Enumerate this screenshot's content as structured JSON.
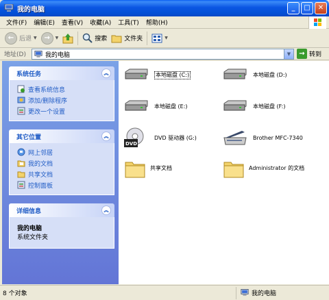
{
  "window": {
    "title": "我的电脑"
  },
  "menubar": {
    "items": [
      "文件(F)",
      "编辑(E)",
      "查看(V)",
      "收藏(A)",
      "工具(T)",
      "帮助(H)"
    ]
  },
  "toolbar": {
    "back": "后退",
    "search": "搜索",
    "folders": "文件夹"
  },
  "address": {
    "label": "地址(D)",
    "value": "我的电脑",
    "go": "转到"
  },
  "panels": {
    "system_tasks": {
      "title": "系统任务",
      "items": [
        "查看系统信息",
        "添加/删除程序",
        "更改一个设置"
      ]
    },
    "other_places": {
      "title": "其它位置",
      "items": [
        "网上邻居",
        "我的文档",
        "共享文档",
        "控制面板"
      ]
    },
    "details": {
      "title": "详细信息",
      "name": "我的电脑",
      "sub": "系统文件夹"
    }
  },
  "items": {
    "disk_c": "本地磁盘 (C:)",
    "disk_d": "本地磁盘 (D:)",
    "disk_e": "本地磁盘 (E:)",
    "disk_f": "本地磁盘 (F:)",
    "dvd": "DVD 驱动器 (G:)",
    "dvd_badge": "DVD",
    "scanner": "Brother MFC-7340",
    "shared_docs": "共享文档",
    "admin_docs": "Administrator 的文档"
  },
  "status": {
    "count": "8 个对象",
    "location": "我的电脑"
  }
}
